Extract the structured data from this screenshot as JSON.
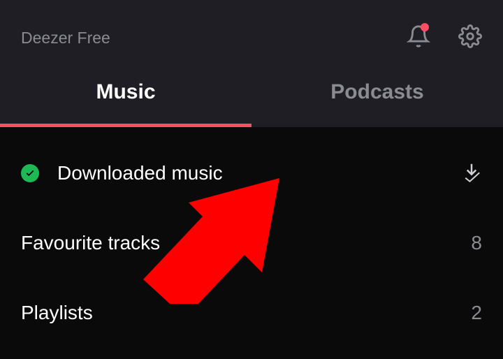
{
  "header": {
    "title": "Deezer Free"
  },
  "tabs": {
    "music": "Music",
    "podcasts": "Podcasts"
  },
  "items": {
    "downloaded": {
      "label": "Downloaded music"
    },
    "favourites": {
      "label": "Favourite tracks",
      "count": "8"
    },
    "playlists": {
      "label": "Playlists",
      "count": "2"
    }
  }
}
